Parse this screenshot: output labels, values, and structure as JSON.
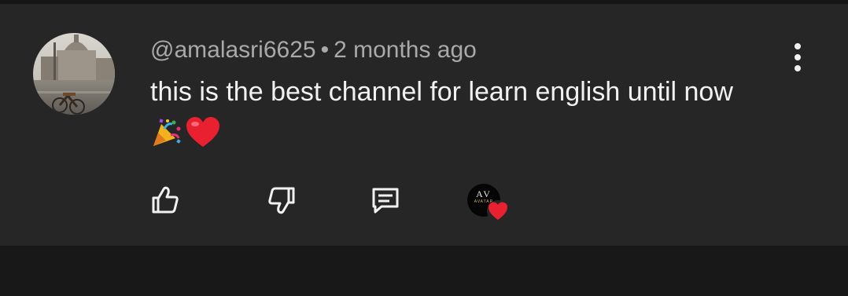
{
  "comment": {
    "author": "@amalasri6625",
    "separator": "•",
    "time": "2 months ago",
    "text": "this is the best channel for learn english until now",
    "emojis": [
      "party-popper",
      "red-heart"
    ]
  },
  "actions": {
    "like_icon": "thumbs-up-icon",
    "dislike_icon": "thumbs-down-icon",
    "reply_icon": "reply-comment-icon",
    "creator_heart": {
      "avatar_initials": "AV",
      "avatar_brand": "AVATAR"
    }
  },
  "menu_icon": "more-vertical-icon",
  "colors": {
    "card_bg": "#262626",
    "page_bg": "#181818",
    "text_primary": "#f1f1f1",
    "text_secondary": "#a9a9a9",
    "heart_red": "#e8202f"
  }
}
